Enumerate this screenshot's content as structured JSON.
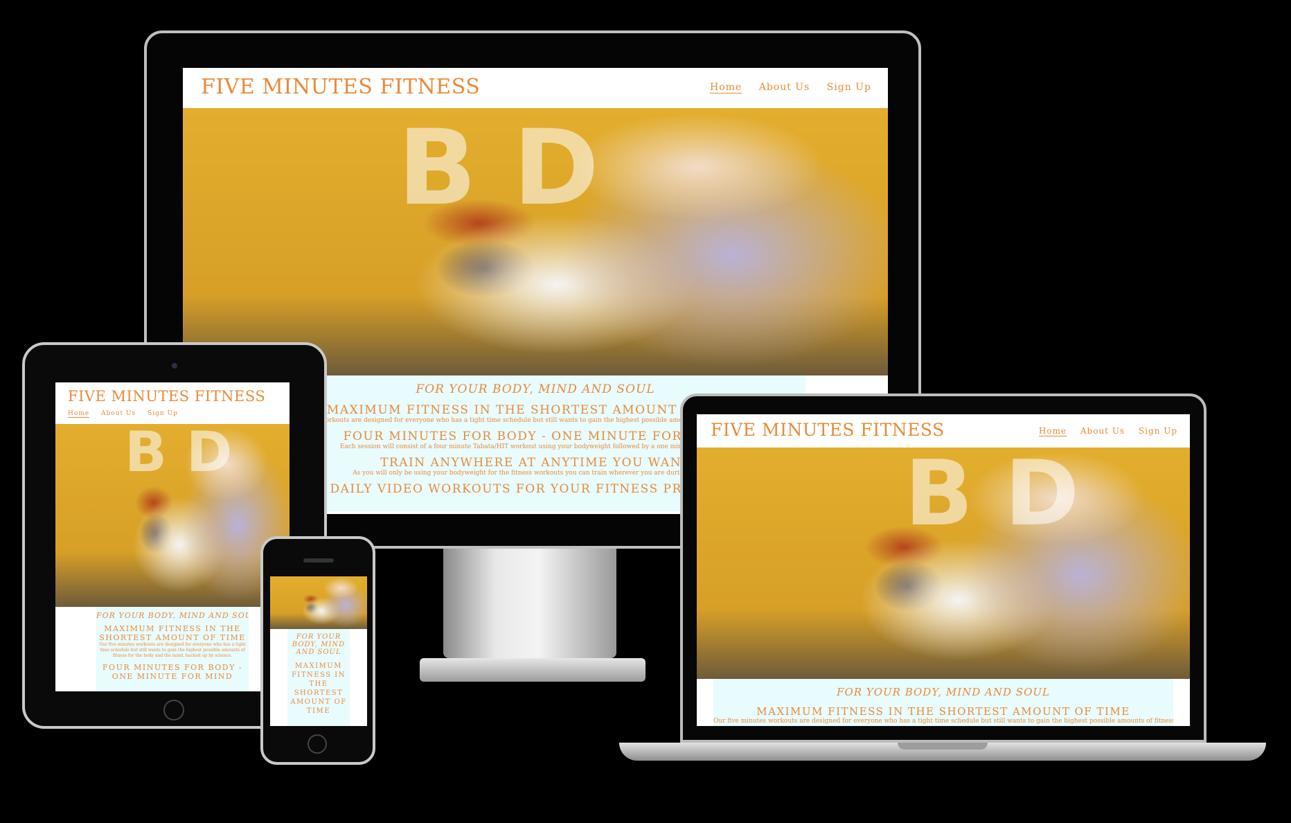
{
  "site": {
    "brand": "FIVE MINUTES FITNESS",
    "nav": [
      {
        "label": "Home",
        "active": true
      },
      {
        "label": "About Us",
        "active": false
      },
      {
        "label": "Sign Up",
        "active": false
      }
    ],
    "tagline": "FOR YOUR BODY, MIND AND SOUL",
    "sections": [
      {
        "title": "MAXIMUM FITNESS IN THE SHORTEST AMOUNT OF TIME",
        "text": "Our five minutes workouts are designed for everyone who has a tight time schedule but still wants to gain the highest possible amounts of fitness for the body and the mind, backed up by science."
      },
      {
        "title": "FOUR MINUTES FOR BODY - ONE MINUTE FOR MIND",
        "text": "Each session will consist of a four minute Tabata/HIT workout using your bodyweight followed by a one minute Meditation."
      },
      {
        "title": "TRAIN ANYWHERE AT ANYTIME YOU WANT",
        "text": "As you will only be using your bodyweight for the fitness workouts you can train wherever you are during your day."
      },
      {
        "title": "DAILY VIDEO WORKOUTS FOR YOUR FITNESS PROGRESS",
        "text": ""
      }
    ],
    "colors": {
      "accent": "#e98a38",
      "panel": "#e8fbfd"
    }
  }
}
